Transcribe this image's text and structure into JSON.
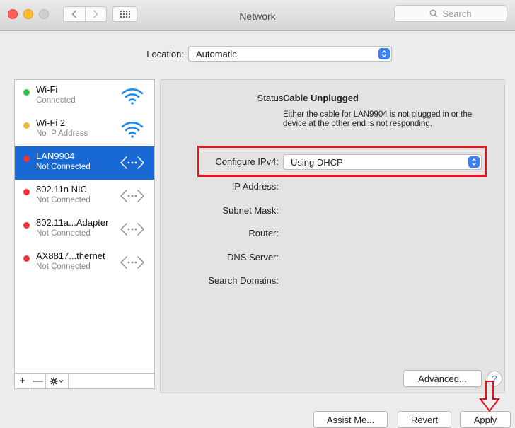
{
  "window": {
    "title": "Network"
  },
  "toolbar": {
    "search_placeholder": "Search"
  },
  "location": {
    "label": "Location:",
    "value": "Automatic"
  },
  "services": [
    {
      "name": "Wi-Fi",
      "status": "Connected",
      "dot_color": "#28c840",
      "icon": "wifi-icon",
      "selected": false
    },
    {
      "name": "Wi-Fi 2",
      "status": "No IP Address",
      "dot_color": "#f5b83d",
      "icon": "wifi-icon",
      "selected": false
    },
    {
      "name": "LAN9904",
      "status": "Not Connected",
      "dot_color": "#f2343a",
      "icon": "ethernet-icon",
      "selected": true
    },
    {
      "name": "802.11n NIC",
      "status": "Not Connected",
      "dot_color": "#f2343a",
      "icon": "ethernet-icon",
      "selected": false
    },
    {
      "name": "802.11a...Adapter",
      "status": "Not Connected",
      "dot_color": "#f2343a",
      "icon": "ethernet-icon",
      "selected": false
    },
    {
      "name": "AX8817...thernet",
      "status": "Not Connected",
      "dot_color": "#f2343a",
      "icon": "ethernet-icon",
      "selected": false
    }
  ],
  "sidebar_tools": {
    "add": "+",
    "remove": "—"
  },
  "detail": {
    "status_label": "Status:",
    "status_value": "Cable Unplugged",
    "status_description": "Either the cable for LAN9904 is not plugged in or the device at the other end is not responding.",
    "configure_label": "Configure IPv4:",
    "configure_value": "Using DHCP",
    "ip_label": "IP Address:",
    "subnet_label": "Subnet Mask:",
    "router_label": "Router:",
    "dns_label": "DNS Server:",
    "domains_label": "Search Domains:"
  },
  "buttons": {
    "advanced": "Advanced...",
    "help": "?",
    "assist": "Assist Me...",
    "revert": "Revert",
    "apply": "Apply"
  },
  "colors": {
    "selection": "#1869d3",
    "highlight_box": "#e2141a",
    "popup_arrows": "#3b7ff5"
  }
}
